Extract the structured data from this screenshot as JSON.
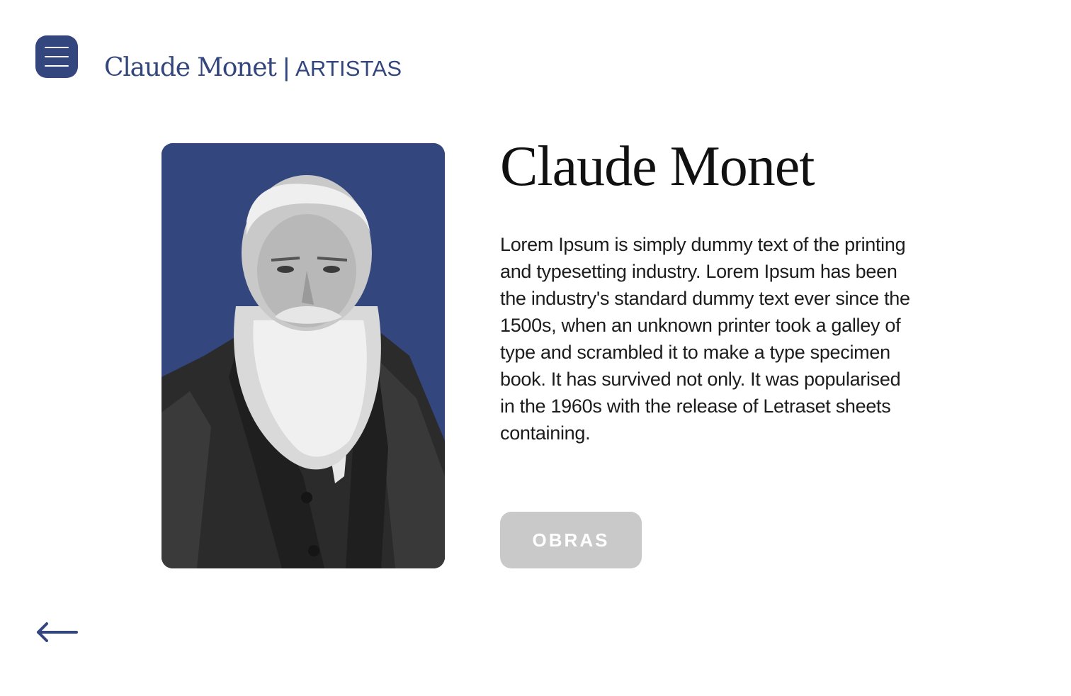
{
  "header": {
    "menu_icon": "hamburger-menu-icon",
    "artist_name": "Claude Monet",
    "separator": "|",
    "section": "ARTISTAS"
  },
  "artist": {
    "name": "Claude Monet",
    "bio": "Lorem Ipsum is simply dummy text of the printing and typesetting industry. Lorem Ipsum has been the industry's standard dummy text ever since the 1500s, when an unknown printer took a galley of type and scrambled it to make a type specimen book. It has survived not only. It was popularised in the 1960s with the release of Letraset sheets containing.",
    "portrait_background": "#34467e"
  },
  "actions": {
    "obras_label": "OBRAS",
    "back_icon": "arrow-left-icon"
  },
  "colors": {
    "brand": "#34467e",
    "button_disabled": "#c9c9c9",
    "text": "#111111"
  }
}
